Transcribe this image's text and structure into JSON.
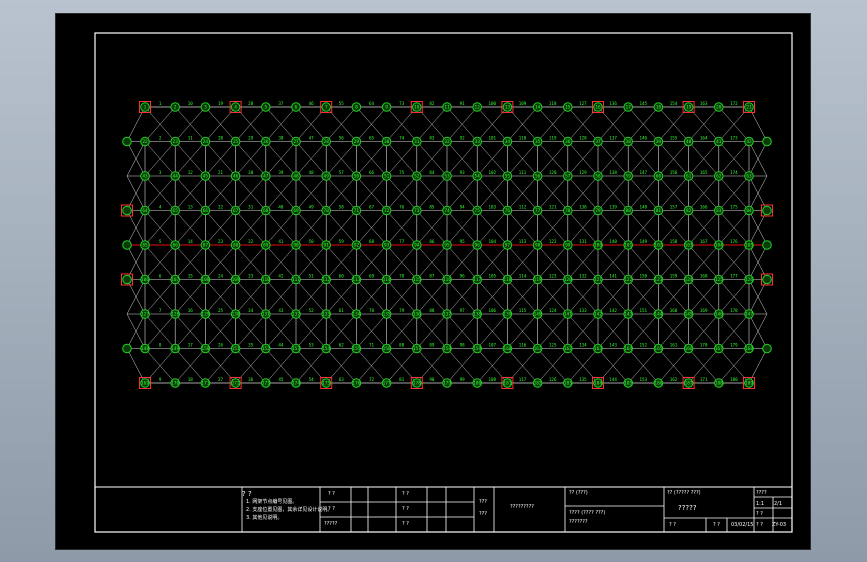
{
  "colors": {
    "background": "#000000",
    "frame": "#ffffff",
    "member": "#d8d8d8",
    "node": "#1fd31f",
    "label": "#35ff35",
    "support": "#ff3030",
    "axis": "#e01010"
  },
  "plan": {
    "columns": 21,
    "rows": 9
  },
  "title_block": {
    "notes_heading": "? ?",
    "notes": [
      "1. 网架节点编号见图。",
      "2. 支座位置见图，其余详见设计说明。",
      "3. 其他见说明。"
    ],
    "sign_a": [
      "? ?",
      "? ?",
      "?????"
    ],
    "sign_b": [
      "? ?",
      "? ?",
      "? ?"
    ],
    "col_mid": [
      "???",
      "???"
    ],
    "project_label": "?????????",
    "drawing_label": "?? (???)",
    "drawing_name_label": "???? (???? ???)",
    "drawing_name": "???????",
    "company_label": "?? (????? ???)",
    "company_name": "?????",
    "scale_label": "????",
    "scale_value": "1:1",
    "sheet_label": "? ?",
    "sheet_value": "2/1",
    "date_label": "? ?",
    "date_value": "03/02/15",
    "drawing_no_label": "? ?",
    "drawing_no": "ZY-03",
    "check_label": "? ?"
  }
}
